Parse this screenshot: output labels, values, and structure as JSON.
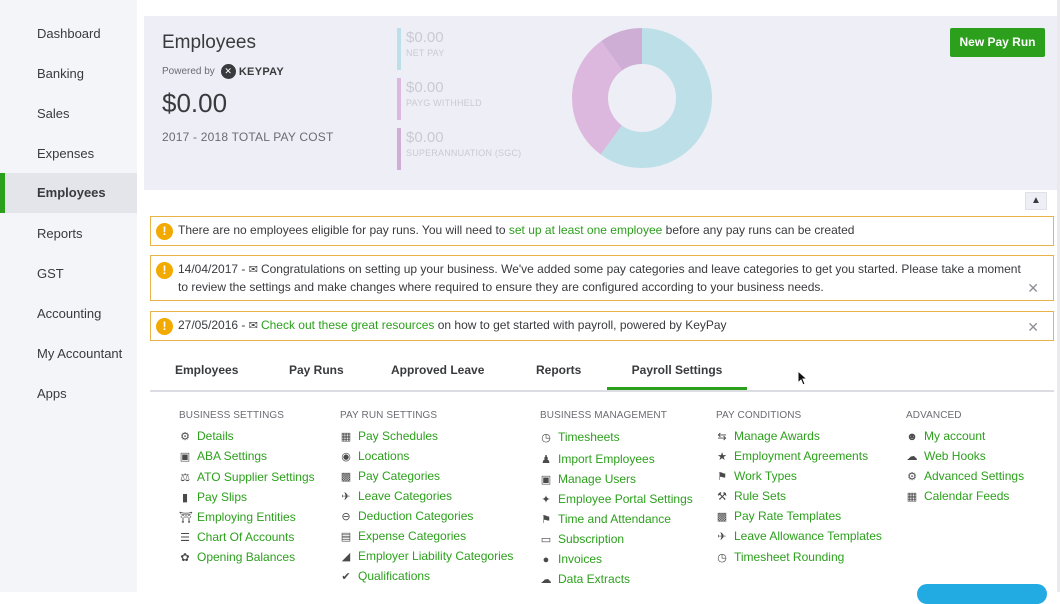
{
  "sidebar": {
    "items": [
      {
        "label": "Dashboard"
      },
      {
        "label": "Banking"
      },
      {
        "label": "Sales"
      },
      {
        "label": "Expenses"
      },
      {
        "label": "Employees",
        "active": true
      },
      {
        "label": "Reports"
      },
      {
        "label": "GST"
      },
      {
        "label": "Accounting"
      },
      {
        "label": "My Accountant"
      },
      {
        "label": "Apps"
      }
    ]
  },
  "hero": {
    "title": "Employees",
    "powered_by": "Powered by",
    "brand": "KEYPAY",
    "total": "$0.00",
    "total_label": "2017 - 2018 TOTAL PAY COST",
    "stats": [
      {
        "value": "$0.00",
        "label": "NET PAY",
        "color": "#a9d4e0"
      },
      {
        "value": "$0.00",
        "label": "PAYG WITHHELD",
        "color": "#d9a9d4"
      },
      {
        "value": "$0.00",
        "label": "SUPERANNUATION (SGC)",
        "color": "#c9a0cc"
      }
    ],
    "donut": {
      "segments": [
        {
          "name": "Net Pay",
          "fraction": 0.6,
          "color": "#bde0e8"
        },
        {
          "name": "PAYG Withheld",
          "fraction": 0.3,
          "color": "#ddb8de"
        },
        {
          "name": "Superannuation (SGC)",
          "fraction": 0.1,
          "color": "#cfaed6"
        }
      ]
    },
    "new_pay_run": "New Pay Run"
  },
  "alerts": [
    {
      "text_before": "There are no employees eligible for pay runs. You will need to ",
      "link": "set up at least one employee",
      "text_after": " before any pay runs can be created"
    },
    {
      "date": "14/04/2017 -",
      "text": "Congratulations on setting up your business. We've added some pay categories and leave categories to get you started. Please take a moment to review the settings and make changes where required to ensure they are configured according to your business needs."
    },
    {
      "date": "27/05/2016 -",
      "link": "Check out these great resources",
      "text_after": " on how to get started with payroll, powered by KeyPay"
    }
  ],
  "tabs": [
    "Employees",
    "Pay Runs",
    "Approved Leave",
    "Reports",
    "Payroll Settings"
  ],
  "active_tab": "Payroll Settings",
  "settings": {
    "business_settings": {
      "heading": "BUSINESS SETTINGS",
      "links": [
        "Details",
        "ABA Settings",
        "ATO Supplier Settings",
        "Pay Slips",
        "Employing Entities",
        "Chart Of Accounts",
        "Opening Balances"
      ]
    },
    "pay_run_settings": {
      "heading": "PAY RUN SETTINGS",
      "links": [
        "Pay Schedules",
        "Locations",
        "Pay Categories",
        "Leave Categories",
        "Deduction Categories",
        "Expense Categories",
        "Employer Liability Categories",
        "Qualifications"
      ]
    },
    "business_management": {
      "heading": "BUSINESS MANAGEMENT",
      "links": [
        "Timesheets",
        "Import Employees",
        "Manage Users",
        "Employee Portal Settings",
        "Time and Attendance",
        "Subscription",
        "Invoices",
        "Data Extracts"
      ]
    },
    "pay_conditions": {
      "heading": "PAY CONDITIONS",
      "links": [
        "Manage Awards",
        "Employment Agreements",
        "Work Types",
        "Rule Sets",
        "Pay Rate Templates",
        "Leave Allowance Templates",
        "Timesheet Rounding"
      ]
    },
    "advanced": {
      "heading": "ADVANCED",
      "links": [
        "My account",
        "Web Hooks",
        "Advanced Settings",
        "Calendar Feeds"
      ]
    }
  },
  "colors": {
    "accent": "#2ca01c",
    "warning": "#f2a900"
  }
}
